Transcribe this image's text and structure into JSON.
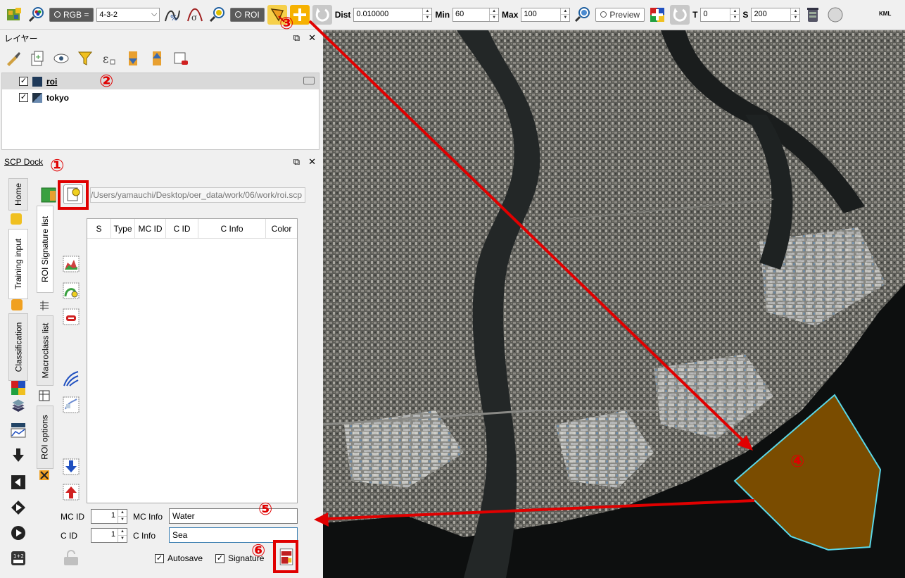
{
  "toolbar": {
    "rgb_label": "RGB =",
    "rgb_value": "4-3-2",
    "roi_label": "ROI",
    "dist_label": "Dist",
    "dist_value": "0.010000",
    "min_label": "Min",
    "min_value": "60",
    "max_label": "Max",
    "max_value": "100",
    "preview_label": "Preview",
    "t_label": "T",
    "t_value": "0",
    "s_label": "S",
    "s_value": "200",
    "kml_label": "KML"
  },
  "layers_panel": {
    "title": "レイヤー",
    "float_icon": "restore-icon",
    "close_icon": "close-icon",
    "layers": [
      {
        "name": "roi",
        "checked": true,
        "selected": true,
        "color": "#1f3a5a"
      },
      {
        "name": "tokyo",
        "checked": true,
        "selected": false,
        "color": "raster"
      }
    ]
  },
  "scp_dock": {
    "title": "SCP Dock",
    "tabs": [
      "Home",
      "Training input",
      "Classification"
    ],
    "inner_tabs": [
      "ROI Signature list",
      "Macroclass list",
      "ROI options"
    ],
    "path": "C:/Users/yamauchi/Desktop/oer_data/work/06/work/roi.scp",
    "table_columns": [
      "S",
      "Type",
      "MC ID",
      "C ID",
      "C Info",
      "Color"
    ],
    "form": {
      "mc_id_label": "MC ID",
      "mc_id_value": "1",
      "mc_info_label": "MC Info",
      "mc_info_value": "Water",
      "c_id_label": "C ID",
      "c_id_value": "1",
      "c_info_label": "C Info",
      "c_info_value": "Sea",
      "autosave_label": "Autosave",
      "autosave_checked": true,
      "signature_label": "Signature",
      "signature_checked": true
    }
  },
  "annotations": {
    "c1": "①",
    "c2": "②",
    "c3": "③",
    "c4": "④",
    "c5": "⑤",
    "c6": "⑥",
    "color": "#e00000"
  },
  "map": {
    "roi_fill": "#7a4c00",
    "roi_stroke": "#5ad7e8"
  }
}
